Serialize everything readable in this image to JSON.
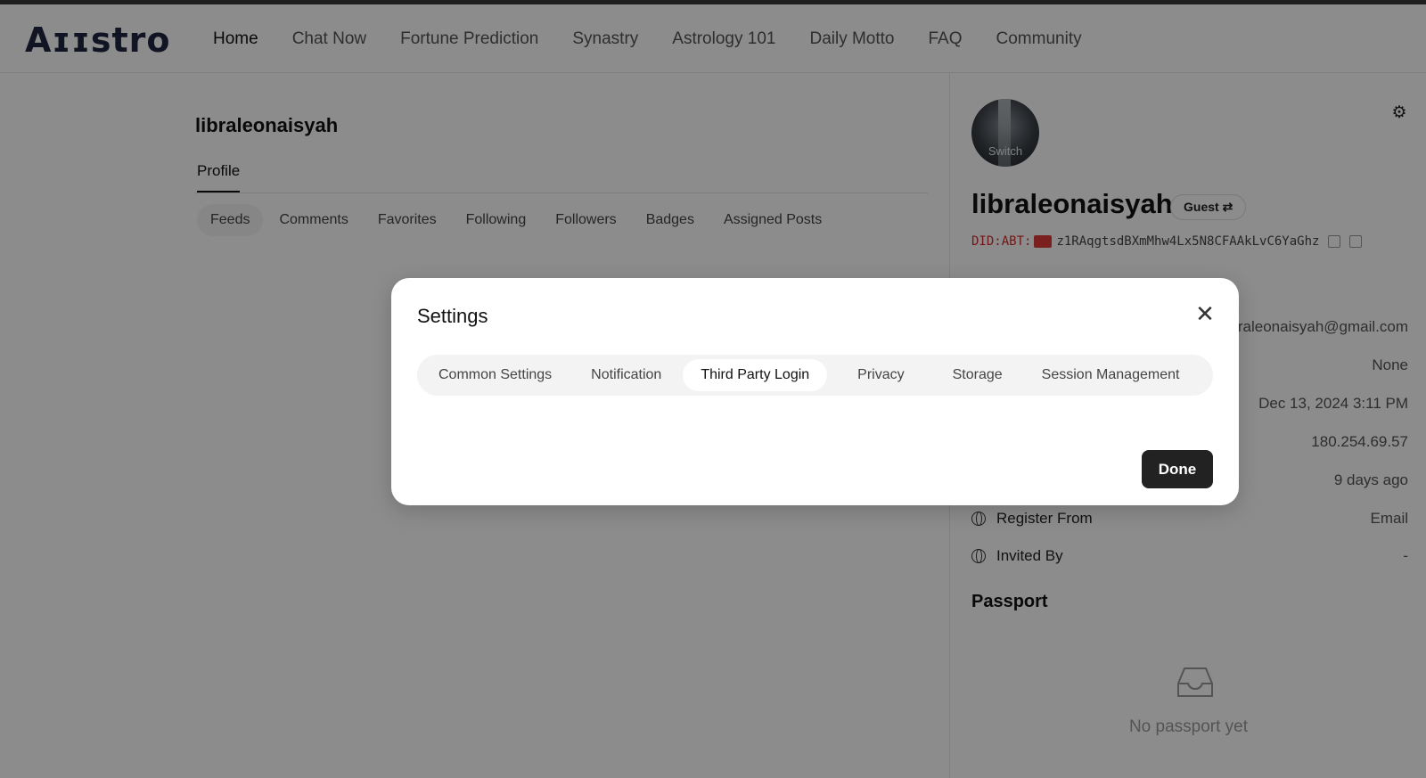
{
  "header": {
    "logo": "Aɪɪstro",
    "nav": [
      "Home",
      "Chat Now",
      "Fortune Prediction",
      "Synastry",
      "Astrology 101",
      "Daily Motto",
      "FAQ",
      "Community"
    ],
    "active_nav": "Home"
  },
  "profile": {
    "username": "libraleonaisyah",
    "tab": "Profile",
    "subtabs": [
      "Feeds",
      "Comments",
      "Favorites",
      "Following",
      "Followers",
      "Badges",
      "Assigned Posts"
    ],
    "active_subtab": "Feeds"
  },
  "right_panel": {
    "avatar_label": "Switch",
    "name": "libraleonaisyah",
    "badge": "Guest ⇄",
    "did_prefix": "DID:ABT:",
    "did_value": "z1RAqgtsdBXmMhw4Lx5N8CFAAkLvC6YaGhz",
    "email_partial": "raleonaisyah@gmail.com",
    "rows": [
      {
        "label": "",
        "value": "None"
      },
      {
        "label": "",
        "value": "Dec 13, 2024 3:11 PM"
      },
      {
        "label": "",
        "value": "180.254.69.57"
      },
      {
        "label": "",
        "value": "9 days ago"
      },
      {
        "label": "Register From",
        "value": "Email"
      },
      {
        "label": "Invited By",
        "value": "-"
      }
    ],
    "passport_title": "Passport",
    "passport_empty": "No passport yet"
  },
  "modal": {
    "title": "Settings",
    "tabs": [
      "Common Settings",
      "Notification",
      "Third Party Login",
      "Privacy",
      "Storage",
      "Session Management"
    ],
    "active_tab": "Third Party Login",
    "done_label": "Done"
  }
}
